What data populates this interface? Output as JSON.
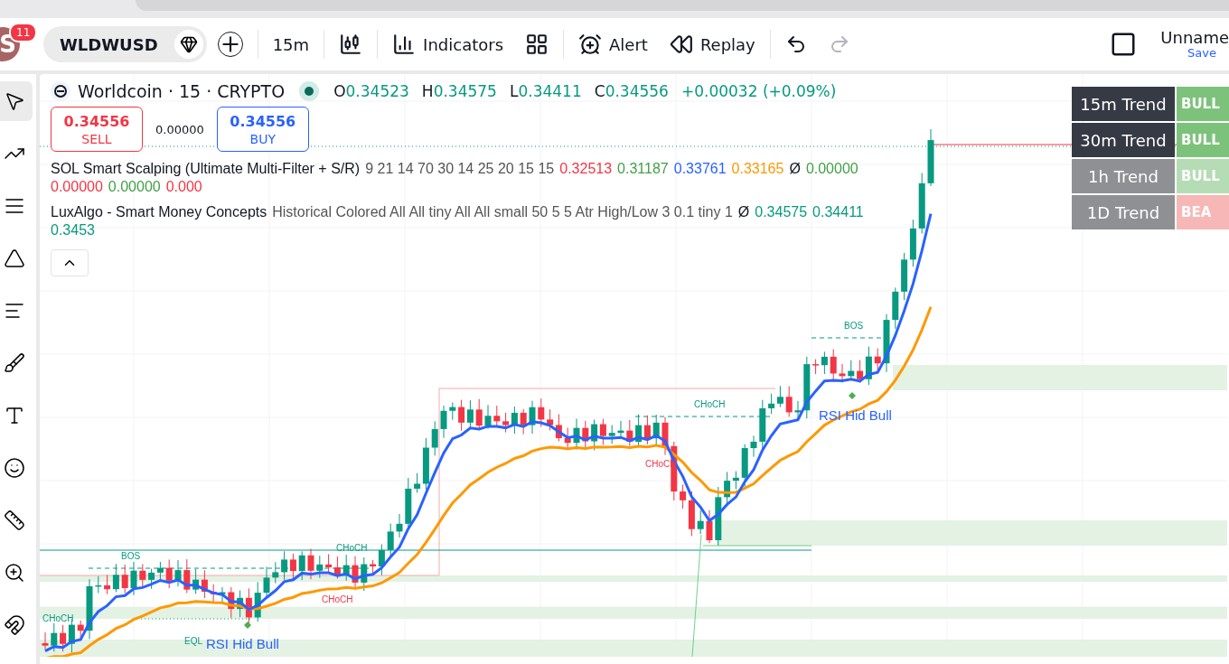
{
  "app_bar": {
    "avatar_letter": "S",
    "notification_count": "11"
  },
  "toolbar": {
    "symbol": "WLDWUSD",
    "interval": "15m",
    "actions": [
      {
        "kind": "indicators",
        "label": "Indicators"
      },
      {
        "kind": "layouts"
      },
      {
        "kind": "alert",
        "label": "Alert"
      },
      {
        "kind": "replay",
        "label": "Replay"
      }
    ],
    "undo_disabled": false,
    "redo_disabled": true,
    "layout_name": "Unname",
    "save_label": "Save"
  },
  "drawing_tools": [
    {
      "kind": "cursor",
      "selected": true
    },
    {
      "kind": "trend-line",
      "selected": false
    },
    {
      "kind": "fib",
      "selected": false
    },
    {
      "kind": "pattern",
      "selected": false
    },
    {
      "kind": "forecast",
      "selected": false
    },
    {
      "kind": "brush",
      "selected": false
    },
    {
      "kind": "text",
      "selected": false
    },
    {
      "kind": "emoji",
      "selected": false
    },
    {
      "kind": "ruler",
      "selected": false
    },
    {
      "kind": "zoom",
      "selected": false
    },
    {
      "kind": "magnet",
      "selected": false
    }
  ],
  "legend": {
    "title": "Worldcoin · 15 · CRYPTO",
    "ohlc": [
      {
        "key": "O",
        "value": "0.34523"
      },
      {
        "key": "H",
        "value": "0.34575"
      },
      {
        "key": "L",
        "value": "0.34411"
      },
      {
        "key": "C",
        "value": "0.34556"
      }
    ],
    "change": "+0.00032 (+0.09%)",
    "sell": {
      "price": "0.34556",
      "label": "SELL"
    },
    "spread": "0.00000",
    "buy": {
      "price": "0.34556",
      "label": "BUY"
    },
    "indicators": [
      {
        "name": "SOL Smart Scalping (Ultimate Multi-Filter + S/R)",
        "params": "9 21 14 70 30 14 25 20 15 15",
        "values": [
          {
            "text": "0.32513",
            "color": "#f23645"
          },
          {
            "text": "0.31187",
            "color": "#43a047"
          },
          {
            "text": "0.33761",
            "color": "#2962ff"
          },
          {
            "text": "0.33165",
            "color": "#ff9800"
          },
          {
            "text": "Ø",
            "color": "#131722"
          },
          {
            "text": "0.00000",
            "color": "#43a047"
          },
          {
            "text": "0.00000",
            "color": "#f23645"
          },
          {
            "text": "0.00000",
            "color": "#43a047"
          },
          {
            "text": "0.000",
            "color": "#f23645"
          }
        ]
      },
      {
        "name": "LuxAlgo - Smart Money Concepts",
        "params": "Historical Colored All All tiny All All small 50 5 5 Atr High/Low 3 0.1 tiny 1",
        "values": [
          {
            "text": "Ø",
            "color": "#131722"
          },
          {
            "text": "0.34575",
            "color": "#089981"
          },
          {
            "text": "0.34411",
            "color": "#089981"
          },
          {
            "text": "0.3453",
            "color": "#089981"
          }
        ]
      }
    ]
  },
  "trend_table": [
    {
      "label": "15m Trend",
      "value": "BULL",
      "kind": "bull",
      "dimmed": false
    },
    {
      "label": "30m Trend",
      "value": "BULL",
      "kind": "bull",
      "dimmed": false
    },
    {
      "label": "1h Trend",
      "value": "BULL",
      "kind": "bull",
      "dimmed": true
    },
    {
      "label": "1D Trend",
      "value": "BEA",
      "kind": "bear",
      "dimmed": true
    }
  ],
  "chart_labels": [
    {
      "text": "CHoCH",
      "color": "#089981"
    },
    {
      "text": "BOS",
      "color": "#089981"
    },
    {
      "text": "CHoCH",
      "color": "#089981"
    },
    {
      "text": "CHoCH",
      "color": "#f23645"
    },
    {
      "text": "EQL",
      "color": "#089981"
    },
    {
      "text": "RSI Hid Bull",
      "color": "#2962ff"
    },
    {
      "text": "CHoCH",
      "color": "#f23645"
    },
    {
      "text": "CHoCH",
      "color": "#089981"
    },
    {
      "text": "BOS",
      "color": "#089981"
    },
    {
      "text": "RSI Hid Bull",
      "color": "#2962ff"
    }
  ]
}
